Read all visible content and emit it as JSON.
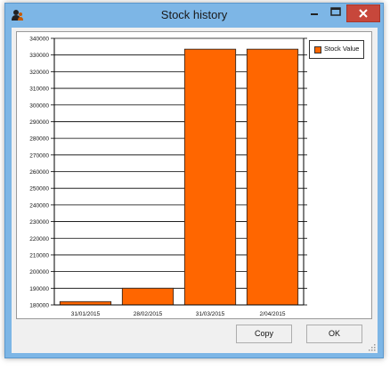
{
  "window": {
    "title": "Stock history"
  },
  "buttons": {
    "copy": "Copy",
    "ok": "OK"
  },
  "legend": {
    "label": "Stock Value"
  },
  "colors": {
    "bar": "#ff6600",
    "bar_stroke": "#222222",
    "titlebar": "#7db6e6",
    "close": "#c7473b"
  },
  "icons": {
    "app": "person-silhouette-icon",
    "minimize": "minimize-icon",
    "maximize": "maximize-icon",
    "close": "close-icon"
  },
  "chart_data": {
    "type": "bar",
    "title": "",
    "xlabel": "",
    "ylabel": "",
    "categories": [
      "31/01/2015",
      "28/02/2015",
      "31/03/2015",
      "2/04/2015"
    ],
    "series": [
      {
        "name": "Stock Value",
        "values": [
          182000,
          190000,
          333500,
          333500
        ]
      }
    ],
    "ylim": [
      180000,
      340000
    ],
    "yticks": [
      180000,
      190000,
      200000,
      210000,
      220000,
      230000,
      240000,
      250000,
      260000,
      270000,
      280000,
      290000,
      300000,
      310000,
      320000,
      330000,
      340000
    ],
    "grid": "horizontal",
    "legend_position": "top-right"
  }
}
